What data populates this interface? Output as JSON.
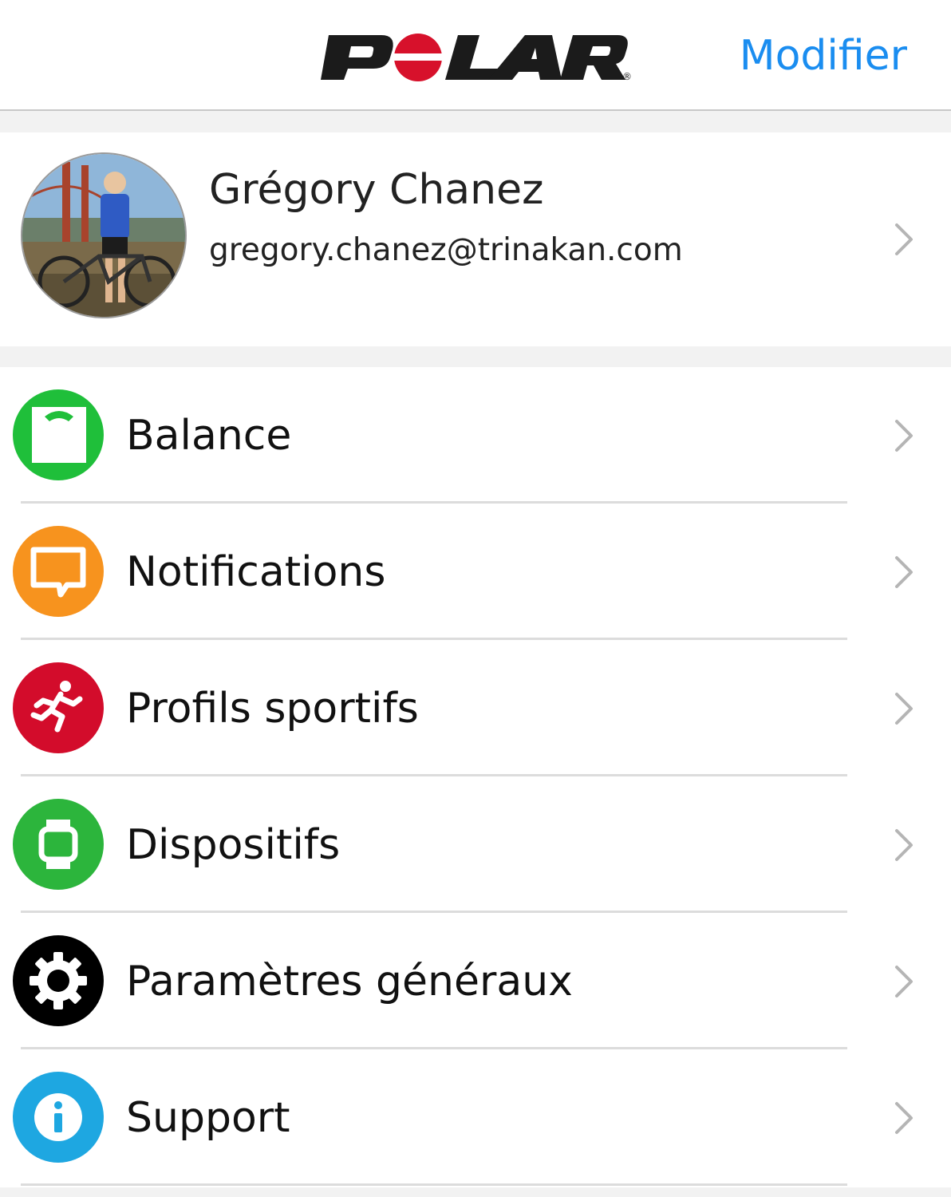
{
  "header": {
    "logo_text": "POLAR",
    "edit_label": "Modifier"
  },
  "profile": {
    "name": "Grégory Chanez",
    "email": "gregory.chanez@trinakan.com"
  },
  "menu": {
    "items": [
      {
        "label": "Balance",
        "icon": "scale-icon",
        "color": "#1fbf3a"
      },
      {
        "label": "Notifications",
        "icon": "speech-bubble-icon",
        "color": "#f7931e"
      },
      {
        "label": "Profils sportifs",
        "icon": "runner-icon",
        "color": "#d30c2b"
      },
      {
        "label": "Dispositifs",
        "icon": "watch-icon",
        "color": "#2cb53c"
      },
      {
        "label": "Paramètres généraux",
        "icon": "gear-icon",
        "color": "#000000"
      },
      {
        "label": "Support",
        "icon": "info-icon",
        "color": "#1ea7e1"
      }
    ]
  },
  "colors": {
    "accent": "#1a8df0",
    "logo_red": "#d7112b"
  }
}
